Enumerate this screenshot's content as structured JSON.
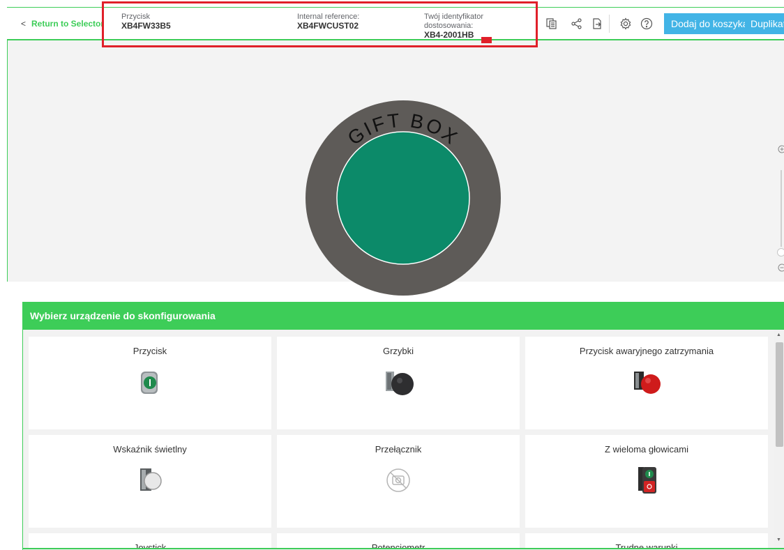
{
  "header": {
    "back_label": "Return to Selector",
    "back_chevron": "<",
    "product_type_label": "Przycisk",
    "product_type_value": "XB4FW33B5",
    "internal_reference_label": "Internal reference:",
    "internal_reference_value": "XB4FWCUST02",
    "custom_id_label_line1": "Twój identyfikator",
    "custom_id_label_line2": "dostosowania:",
    "custom_id_value": "XB4-2001HB",
    "icons": [
      "copy-icon",
      "share-icon",
      "export-icon",
      "settings-icon",
      "help-icon"
    ],
    "add_to_cart_label": "Dodaj do koszyka",
    "duplicate_label": "Duplikat",
    "accent_color": "#3dcd58",
    "button_color": "#42b4e6"
  },
  "preview": {
    "cap_text": "GIFT BOX",
    "button_color": "#0c8a69",
    "ring_color": "#5e5b58",
    "zoom_icons": [
      "zoom-in-icon",
      "zoom-out-icon"
    ]
  },
  "device_panel": {
    "title": "Wybierz urządzenie do skonfigurowania",
    "tiles": [
      {
        "label": "Przycisk",
        "icon": "pushbutton-green-icon"
      },
      {
        "label": "Grzybki",
        "icon": "mushroom-black-icon"
      },
      {
        "label": "Przycisk awaryjnego zatrzymania",
        "icon": "emergency-stop-red-icon"
      },
      {
        "label": "Wskaźnik świetlny",
        "icon": "pilot-light-white-icon"
      },
      {
        "label": "Przełącznik",
        "icon": "no-image-icon"
      },
      {
        "label": "Z wieloma głowicami",
        "icon": "double-head-icon"
      },
      {
        "label": "Joystick",
        "icon": ""
      },
      {
        "label": "Potencjometr",
        "icon": ""
      },
      {
        "label": "Trudne warunki",
        "icon": ""
      }
    ]
  }
}
